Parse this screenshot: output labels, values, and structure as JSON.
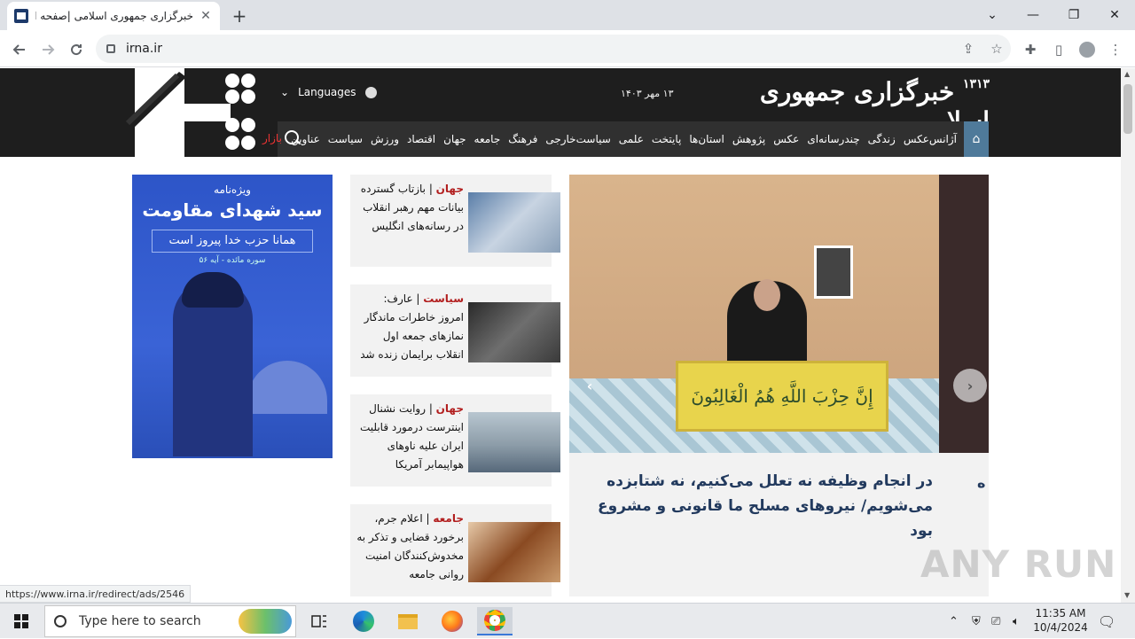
{
  "browser": {
    "tab_title": "خبرگزاری جمهوری اسلامی |صفحه اول",
    "tab_close": "✕",
    "new_tab": "+",
    "url": "irna.ir",
    "status_url": "https://www.irna.ir/redirect/ads/2546",
    "controls": {
      "minimize": "—",
      "restore": "❐",
      "close": "✕",
      "dropdown": "⌄"
    }
  },
  "site": {
    "brand": "خبرگزاری جمهوری اسلامی",
    "brand_year": "۱۳۱۳",
    "date": "۱۳ مهر ۱۴۰۳",
    "languages": "Languages",
    "nav": [
      "عناوین",
      "سیاست",
      "ورزش",
      "اقتصاد",
      "جهان",
      "جامعه",
      "فرهنگ",
      "سیاست‌خارجی",
      "علمی",
      "پایتخت",
      "استان‌ها",
      "پژوهش",
      "عکس",
      "چندرسانه‌ای",
      "زندگی",
      "آژانس‌عکس"
    ],
    "bazar": "بازار"
  },
  "ad": {
    "line1": "ویژه‌نامه",
    "line2": "سید شهدای مقاومت",
    "line3": "همانا حزب خدا پیروز است",
    "line4": "سوره مائده - آیه ۵۶"
  },
  "news": [
    {
      "category": "جهان",
      "text": "بازتاب گسترده بیانات مهم رهبر انقلاب در رسانه‌های انگلیس"
    },
    {
      "category": "سیاست",
      "text": "عارف: امروز خاطرات ماندگار نمازهای جمعه اول انقلاب برایمان زنده شد"
    },
    {
      "category": "جهان",
      "text": "روایت نشنال اینترست درمورد قابلیت ایران علیه ناوهای هواپیمابر آمریکا"
    },
    {
      "category": "جامعه",
      "text": "اعلام جرم، برخورد قضایی و تذکر به مخدوش‌کنندگان امنیت روانی جامعه"
    }
  ],
  "slider": {
    "caption": "در انجام وظیفه نه تعلل می‌کنیم، نه شتابزده می‌شویم/ نیروهای مسلح ما قانونی و مشروع بود",
    "caption_next": "ه",
    "podium_text": "إِنَّ حِزْبَ اللَّهِ هُمُ الْغَالِبُونَ",
    "prev": "‹",
    "next": "›"
  },
  "watermark": "ANY RUN",
  "taskbar": {
    "search_placeholder": "Type here to search",
    "time": "11:35 AM",
    "date": "10/4/2024"
  }
}
